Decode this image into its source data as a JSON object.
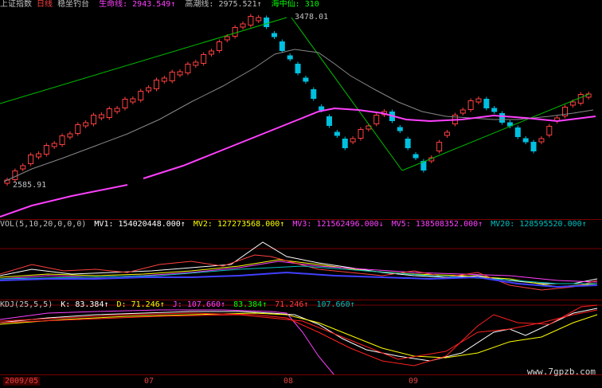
{
  "main_panel": {
    "title": "上证指数",
    "period": "日线",
    "indicator": "稳坐钓台",
    "lines": [
      {
        "label": "生命线:",
        "value": "2943.549↑",
        "color": "#ff40ff"
      },
      {
        "label": "高潮线:",
        "value": "2975.521↑",
        "color": "#c0c0c0"
      },
      {
        "label": "海中仙:",
        "value": "310",
        "color": "#00ff00"
      }
    ],
    "high_label": "3478.01",
    "low_label": "2585.91"
  },
  "vol_panel": {
    "name": "VOL(5,10,20,0,0,0)",
    "items": [
      {
        "label": "MV1:",
        "value": "154020448.000↑",
        "color": "#ffffff"
      },
      {
        "label": "MV2:",
        "value": "127273568.000↑",
        "color": "#ffff00"
      },
      {
        "label": "MV3:",
        "value": "121562496.000↓",
        "color": "#ff40ff"
      },
      {
        "label": "MV5:",
        "value": "138508352.000↑",
        "color": "#ff40ff"
      },
      {
        "label": "MV20:",
        "value": "128595520.000↑",
        "color": "#00c0c0"
      }
    ]
  },
  "kdj_panel": {
    "name": "KDJ(25,5,5)",
    "items": [
      {
        "label": "K:",
        "value": "83.384↑",
        "color": "#ffffff"
      },
      {
        "label": "D:",
        "value": "71.246↑",
        "color": "#ffff00"
      },
      {
        "label": "J:",
        "value": "107.660↑",
        "color": "#ff40ff"
      },
      {
        "label": "",
        "value": "83.384↑",
        "color": "#00ff00"
      },
      {
        "label": "",
        "value": "71.246↑",
        "color": "#ff4040"
      },
      {
        "label": "",
        "value": "107.660↑",
        "color": "#00c0c0"
      }
    ]
  },
  "dates": [
    "2009/05",
    "07",
    "08",
    "09"
  ],
  "watermark": "www.7gpzb.com"
}
